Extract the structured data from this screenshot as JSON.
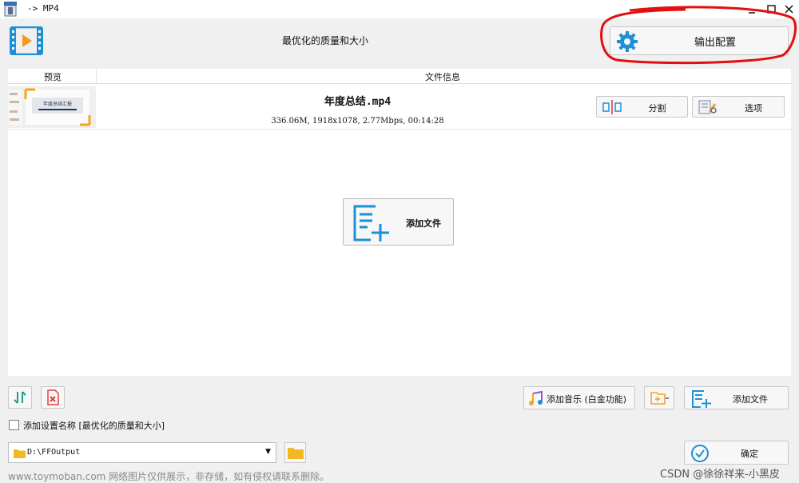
{
  "window": {
    "title": "-> MP4"
  },
  "header": {
    "title": "最优化的质量和大小",
    "output_config_label": "输出配置"
  },
  "table": {
    "columns": [
      "预览",
      "文件信息"
    ],
    "rows": [
      {
        "filename": "年度总结.mp4",
        "info": "336.06M, 1918x1078, 2.77Mbps, 00:14:28",
        "thumb_text": "年度总结汇报",
        "split_label": "分割",
        "options_label": "选项"
      }
    ],
    "add_file_center_label": "添加文件"
  },
  "toolbar": {
    "add_music_label": "添加音乐 (白金功能)",
    "add_file_label": "添加文件",
    "add_setting_name_label": "添加设置名称 [最优化的质量和大小]",
    "output_path": "D:\\FFOutput",
    "ok_label": "确定"
  },
  "overlay": {
    "watermark": "www.toymoban.com 网络图片仅供展示，非存储，如有侵权请联系删除。",
    "csdn": "CSDN @徐徐祥来-小黑皮"
  },
  "colors": {
    "accent_blue": "#1e90d6",
    "annotation_red": "#e01010",
    "folder_yellow": "#f2b824"
  }
}
